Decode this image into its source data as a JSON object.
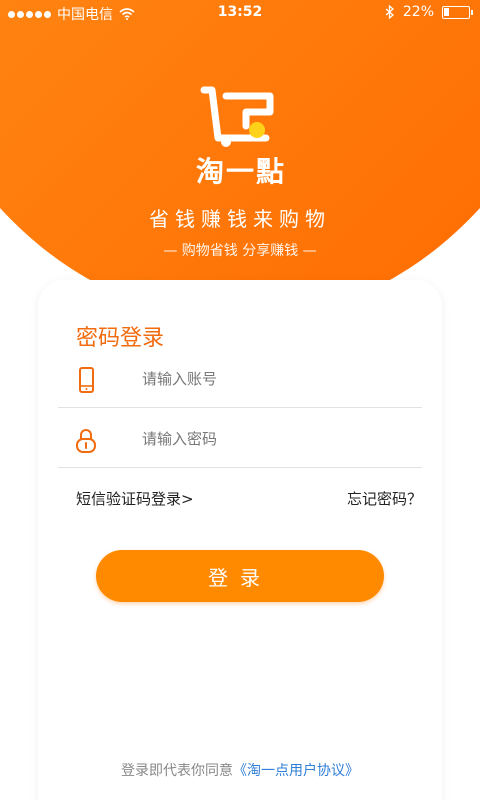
{
  "status_bar": {
    "carrier": "中国电信",
    "time": "13:52",
    "battery": "22%",
    "battery_level": 0.22
  },
  "brand": {
    "app_name": "淘一點",
    "slogan": "省钱赚钱来购物",
    "sub_slogan": "— 购物省钱  分享赚钱 —"
  },
  "login": {
    "title": "密码登录",
    "account_placeholder": "请输入账号",
    "password_placeholder": "请输入密码",
    "sms_login_label": "短信验证码登录>",
    "forgot_label": "忘记密码？",
    "submit_label": "登录"
  },
  "footer": {
    "agreement_prefix": "登录即代表你同意",
    "agreement_link": "《淘一点用户协议》"
  },
  "colors": {
    "accent": "#ff8a00",
    "title": "#f26b0f",
    "link": "#2f7fd8"
  }
}
